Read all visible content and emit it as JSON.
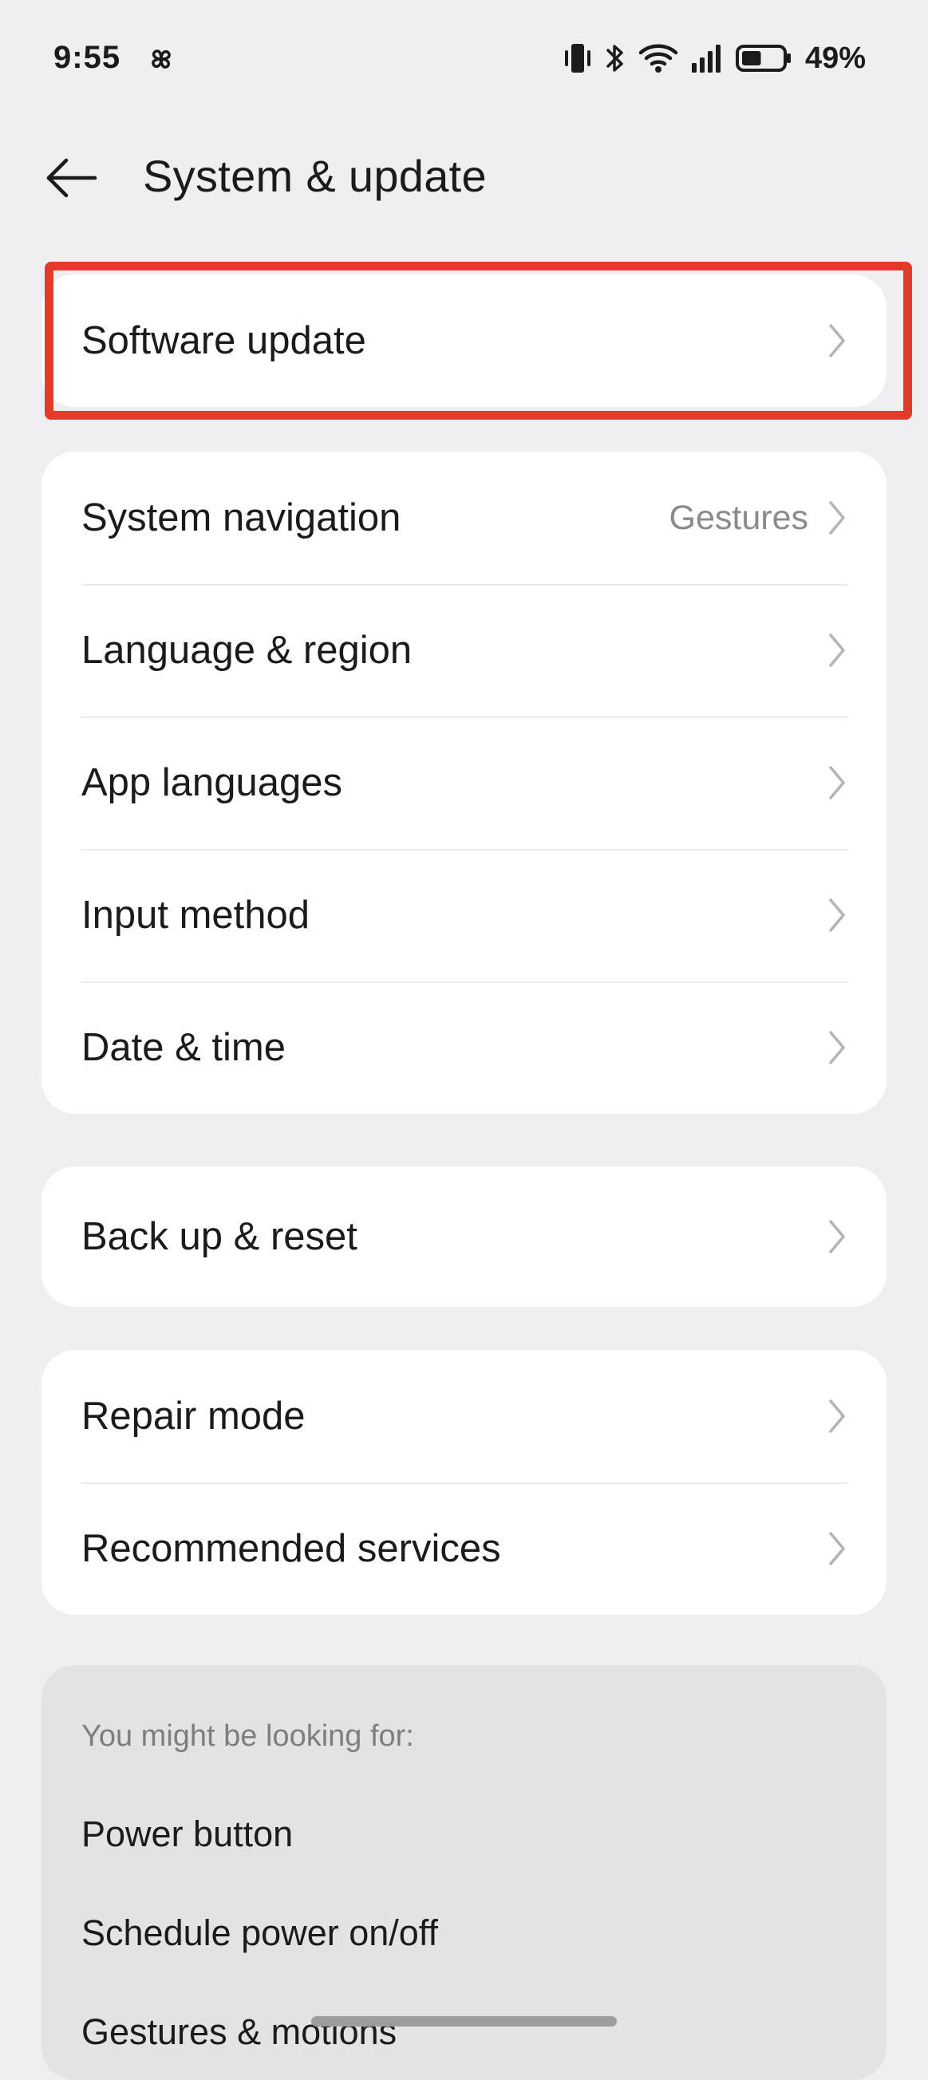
{
  "status_bar": {
    "time": "9:55",
    "battery_percent": "49%",
    "left_icon": "pinwheel-icon",
    "right_icons": [
      "vibrate-icon",
      "bluetooth-icon",
      "wifi-icon",
      "signal-icon",
      "battery-icon"
    ],
    "battery_level": 0.49
  },
  "header": {
    "title": "System & update",
    "back_icon": "back-arrow-icon"
  },
  "groups": {
    "software": {
      "items": [
        {
          "label": "Software update",
          "value": ""
        }
      ]
    },
    "system": {
      "items": [
        {
          "label": "System navigation",
          "value": "Gestures"
        },
        {
          "label": "Language & region",
          "value": ""
        },
        {
          "label": "App languages",
          "value": ""
        },
        {
          "label": "Input method",
          "value": ""
        },
        {
          "label": "Date & time",
          "value": ""
        }
      ]
    },
    "backup": {
      "items": [
        {
          "label": "Back up & reset",
          "value": ""
        }
      ]
    },
    "services": {
      "items": [
        {
          "label": "Repair mode",
          "value": ""
        },
        {
          "label": "Recommended services",
          "value": ""
        }
      ]
    }
  },
  "suggestions": {
    "title": "You might be looking for:",
    "items": [
      "Power button",
      "Schedule power on/off",
      "Gestures & motions"
    ]
  },
  "colors": {
    "background": "#efeff1",
    "card": "#ffffff",
    "highlight": "#e53a2b",
    "secondary_text": "#8a8a8f",
    "chevron": "#b4b4b8"
  }
}
